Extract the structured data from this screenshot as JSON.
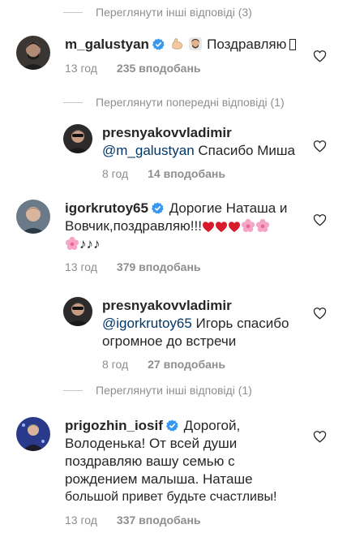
{
  "view_more_top": "Переглянути інші відповіді (3)",
  "view_prev": "Переглянути попередні відповіді (1)",
  "view_more_bottom": "Переглянути інші відповіді (1)",
  "comments": [
    {
      "username": "m_galustyan",
      "text": "Поздравляю",
      "time": "13 год",
      "likes": "235 вподобань"
    },
    {
      "username": "presnyakovvladimir",
      "mention": "@m_galustyan",
      "text": "Спасибо Миша",
      "time": "8 год",
      "likes": "14 вподобань"
    },
    {
      "username": "igorkrutoy65",
      "line1": "Дорогие Наташа и",
      "line2": "Вовчик,поздравляю!!!",
      "time": "13 год",
      "likes": "379 вподобань"
    },
    {
      "username": "presnyakovvladimir",
      "mention": "@igorkrutoy65",
      "line1": "Игорь спасибо",
      "line2": "огромное до встречи",
      "time": "8 год",
      "likes": "27 вподобань"
    },
    {
      "username": "prigozhin_iosif",
      "line1": "Дорогой,",
      "line2": "Володенька! От всей души",
      "line3": "поздравляю вашу семью с",
      "line4": "рождением малыша. Наташе",
      "line5": "большой привет будьте счастливы!",
      "time": "13 год",
      "likes": "337 вподобань"
    }
  ]
}
